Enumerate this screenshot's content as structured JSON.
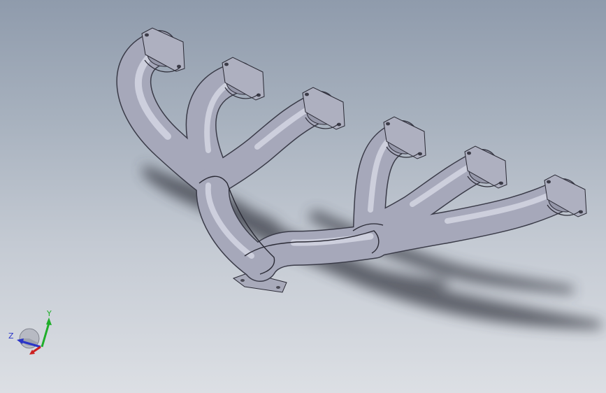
{
  "viewport": {
    "background_top": "#8f9bac",
    "background_bottom": "#dcdfe4",
    "model": {
      "part_color": "#a4a6b8",
      "edge_color": "#2a2a35",
      "primary_count": 6
    }
  },
  "triad": {
    "x_label": "",
    "y_label": "Y",
    "z_label": "Z",
    "x_color": "#cc2020",
    "y_color": "#1fae2a",
    "z_color": "#2a34c8"
  }
}
